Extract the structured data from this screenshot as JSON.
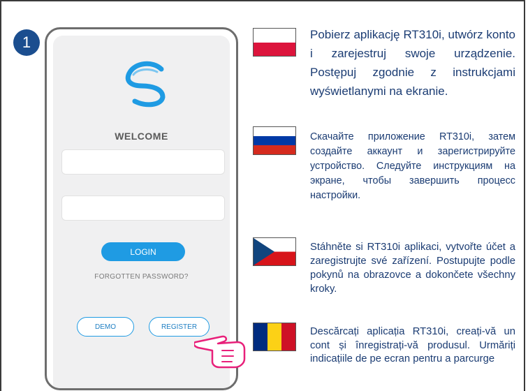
{
  "step": {
    "number": "1"
  },
  "app": {
    "welcome": "WELCOME",
    "username_value": "",
    "password_value": "",
    "login_label": "LOGIN",
    "forgot_label": "FORGOTTEN PASSWORD?",
    "demo_label": "DEMO",
    "register_label": "REGISTER"
  },
  "colors": {
    "accent_blue": "#1f9be3",
    "text_navy": "#1b3c73",
    "badge_blue": "#1b4e8f",
    "hand_pink": "#e8207a"
  },
  "languages": [
    {
      "flag": "poland-flag",
      "text": "Pobierz aplikację RT310i, utwórz konto i zarejestruj swoje urządzenie. Postępuj zgodnie z instrukcjami wyświetlanymi na ekranie."
    },
    {
      "flag": "russia-flag",
      "text": "Скачайте приложение RT310i, затем создайте аккаунт и зарегистрируйте устройство. Следуйте инструкциям на экране, чтобы завершить процесс настройки."
    },
    {
      "flag": "czech-flag",
      "text": "Stáhněte si RT310i aplikaci, vytvořte účet a zaregistrujte své zařízení. Postupujte podle pokynů na obrazovce a dokončete všechny kroky."
    },
    {
      "flag": "romania-flag",
      "text": "Descărcați aplicația RT310i, creați-vă un cont și înregistrați-vă produsul. Urmăriți indicațiile de pe ecran pentru a parcurge"
    }
  ]
}
